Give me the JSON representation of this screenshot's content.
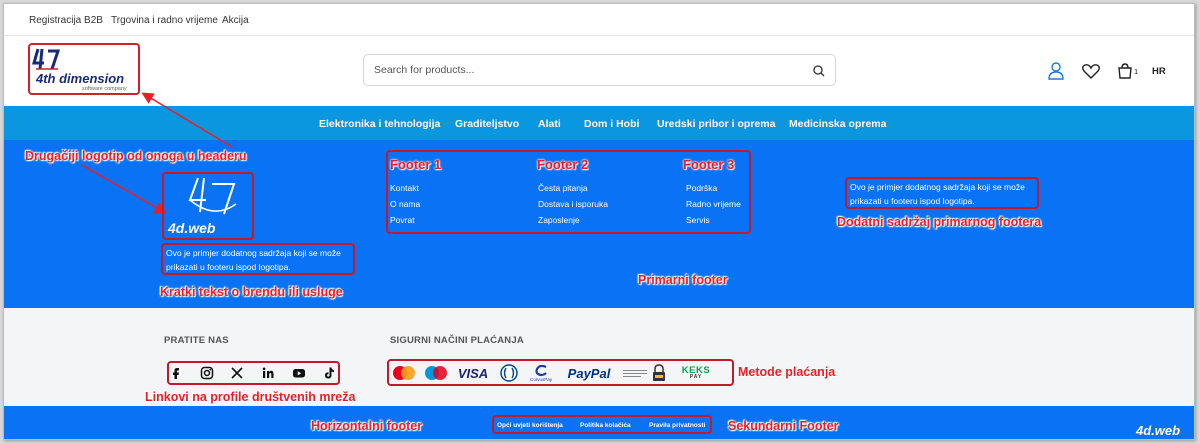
{
  "topbar": {
    "links": [
      "Registracija B2B",
      "Trgovina i radno vrijeme",
      "Akcija"
    ]
  },
  "header": {
    "logo_text": "4th dimension",
    "logo_sub": "software company",
    "search_placeholder": "Search for products...",
    "cart_count": "1",
    "language": "HR"
  },
  "nav": {
    "items": [
      "Elektronika i tehnologija",
      "Graditeljstvo",
      "Alati",
      "Dom i Hobi",
      "Uredski pribor i oprema",
      "Medicinska oprema"
    ]
  },
  "annotations": {
    "logo_diff": "Drugačiji logotip od onoga u headeru",
    "brand_text": "Kratki tekst o brendu ili usluge",
    "primary_footer": "Primarni footer",
    "extra_content": "Dodatni sadržaj primarnog footera",
    "social_links": "Linkovi na profile društvenih mreža",
    "payment_methods": "Metode plaćanja",
    "horizontal_footer": "Horizontalni footer",
    "secondary_footer": "Sekundarni Footer"
  },
  "primary_footer": {
    "logo_text": "4d.web",
    "brand_text_line1": "Ovo je primjer dodatnog sadržaja koji se može",
    "brand_text_line2": "prikazati u footeru ispod logotipa.",
    "columns": [
      {
        "title": "Footer 1",
        "links": [
          "Kontakt",
          "O nama",
          "Povrat"
        ]
      },
      {
        "title": "Footer 2",
        "links": [
          "Česta pitanja",
          "Dostava i isporuka",
          "Zaposlenje"
        ]
      },
      {
        "title": "Footer 3",
        "links": [
          "Podrška",
          "Radno vrijeme",
          "Servis"
        ]
      }
    ],
    "extra_line1": "Ovo je primjer dodatnog sadržaja koji se može",
    "extra_line2": "prikazati u footeru ispod logotipa."
  },
  "follow": {
    "title": "PRATITE NAS",
    "icons": [
      "facebook-icon",
      "instagram-icon",
      "x-icon",
      "linkedin-icon",
      "youtube-icon",
      "tiktok-icon"
    ]
  },
  "payments": {
    "title": "SIGURNI NAČINI PLAĆANJA",
    "visa": "VISA",
    "paypal": "PayPal",
    "corvuspay": "CorvusPay",
    "keks_top": "KEKS",
    "keks_bottom": "PAY"
  },
  "secondary_footer": {
    "links": [
      "Opći uvjeti korištenja",
      "Politika kolačića",
      "Pravila privatnosti"
    ],
    "watermark": "4d.web"
  },
  "colors": {
    "nav_blue": "#0a97e0",
    "footer_blue": "#0a73f5",
    "annotation_red": "#ee1c24"
  }
}
